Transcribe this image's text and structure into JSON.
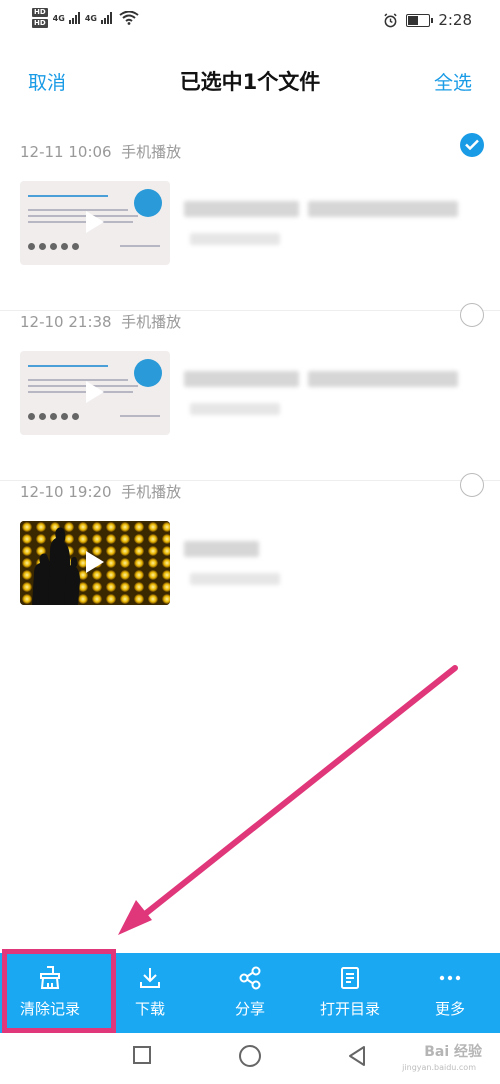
{
  "status_bar": {
    "hd1": "HD",
    "hd2": "HD",
    "net1": "4G",
    "net2": "4G",
    "time": "2:28",
    "battery_level": 0.45,
    "icons": [
      "signal-icon",
      "wifi-icon",
      "alarm-icon",
      "battery-icon"
    ]
  },
  "header": {
    "cancel": "取消",
    "title": "已选中1个文件",
    "select_all": "全选"
  },
  "items": [
    {
      "time": "12-11 10:06",
      "source": "手机播放",
      "selected": true,
      "thumb": "slide"
    },
    {
      "time": "12-10 21:38",
      "source": "手机播放",
      "selected": false,
      "thumb": "slide"
    },
    {
      "time": "12-10 19:20",
      "source": "手机播放",
      "selected": false,
      "thumb": "photo"
    }
  ],
  "toolbar": [
    {
      "label": "清除记录",
      "icon": "clear-record-icon",
      "highlighted": true
    },
    {
      "label": "下载",
      "icon": "download-icon",
      "highlighted": false
    },
    {
      "label": "分享",
      "icon": "share-icon",
      "highlighted": false
    },
    {
      "label": "打开目录",
      "icon": "open-directory-icon",
      "highlighted": false
    },
    {
      "label": "更多",
      "icon": "more-icon",
      "highlighted": false
    }
  ],
  "watermark": {
    "text": "Bai 经验",
    "sub": "jingyan.baidu.com"
  },
  "colors": {
    "accent": "#1a9be6",
    "toolbar": "#1aa8f3",
    "annotation": "#e0367a"
  }
}
